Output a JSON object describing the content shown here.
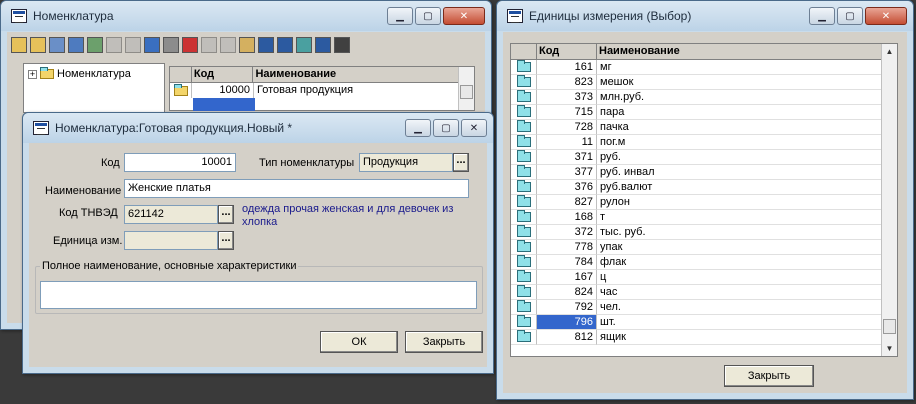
{
  "nom_window": {
    "title": "Номенклатура",
    "toolbar_icons": [
      "new-icon",
      "open-folder-icon",
      "calculator-icon",
      "find-icon",
      "table-add-icon",
      "table-delete-icon",
      "table-edit-icon",
      "move-icon",
      "copy-icon",
      "print-icon",
      "arrow-icon",
      "filter-icon",
      "clipboard-icon",
      "document-icon",
      "properties-icon",
      "tree-icon",
      "help-icon",
      "pointer-help-icon"
    ],
    "tree_root": "Номенклатура",
    "columns": [
      "Код",
      "Наименование"
    ],
    "rows": [
      {
        "code": "10000",
        "name": "Готовая продукция"
      }
    ]
  },
  "item_window": {
    "title": "Номенклатура:Готовая продукция.Новый *",
    "code_label": "Код",
    "code_value": "10001",
    "type_label": "Тип номенклатуры",
    "type_value": "Продукция",
    "name_label": "Наименование",
    "name_value": "Женские платья",
    "tnved_label": "Код ТНВЭД",
    "tnved_value": "621142",
    "tnved_desc": "одежда прочая женская и для девочек из хлопка",
    "unit_label": "Единица изм.",
    "unit_value": "",
    "fullname_legend": "Полное наименование, основные характеристики",
    "fullname_value": "",
    "ok_label": "ОК",
    "close_label": "Закрыть"
  },
  "units_window": {
    "title": "Единицы измерения (Выбор)",
    "columns": [
      "Код",
      "Наименование"
    ],
    "rows": [
      {
        "code": "161",
        "name": "мг"
      },
      {
        "code": "823",
        "name": "мешок"
      },
      {
        "code": "373",
        "name": "млн.руб."
      },
      {
        "code": "715",
        "name": "пара"
      },
      {
        "code": "728",
        "name": "пачка"
      },
      {
        "code": "11",
        "name": "пог.м"
      },
      {
        "code": "371",
        "name": "руб."
      },
      {
        "code": "377",
        "name": "руб. инвал"
      },
      {
        "code": "376",
        "name": "руб.валют"
      },
      {
        "code": "827",
        "name": "рулон"
      },
      {
        "code": "168",
        "name": "т"
      },
      {
        "code": "372",
        "name": "тыс. руб."
      },
      {
        "code": "778",
        "name": "упак"
      },
      {
        "code": "784",
        "name": "флак"
      },
      {
        "code": "167",
        "name": "ц"
      },
      {
        "code": "824",
        "name": "час"
      },
      {
        "code": "792",
        "name": "чел."
      },
      {
        "code": "796",
        "name": "шт."
      },
      {
        "code": "812",
        "name": "ящик"
      }
    ],
    "selected_index": 17,
    "close_label": "Закрыть"
  },
  "colors": {
    "selection": "#3366cc",
    "folder": "#8fe0e8",
    "dialog_bg": "#d4d0c8"
  }
}
